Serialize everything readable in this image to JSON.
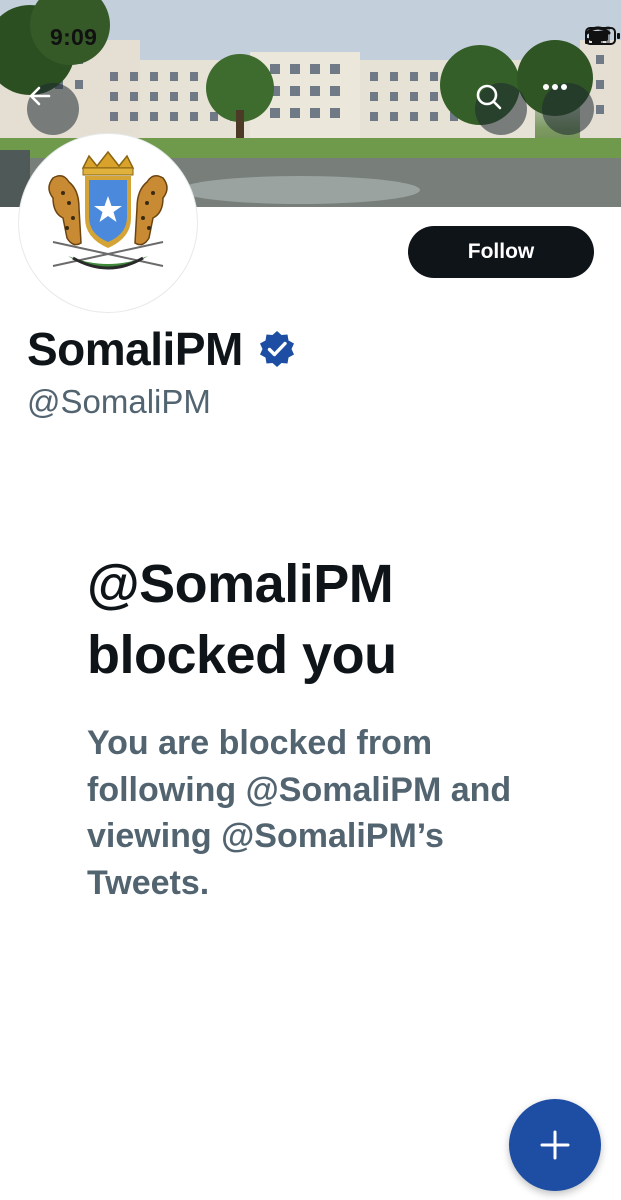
{
  "status_bar": {
    "time": "9:09"
  },
  "header": {
    "back_icon": "arrow-left-icon",
    "search_icon": "search-icon",
    "more_icon": "more-horizontal-icon"
  },
  "profile": {
    "display_name": "SomaliPM",
    "handle": "@SomaliPM",
    "verified": true,
    "verified_color": "#1d4ea3",
    "follow_label": "Follow"
  },
  "blocked": {
    "title": "@SomaliPM blocked you",
    "description": "You are blocked from following @SomaliPM and viewing @SomaliPM’s Tweets."
  },
  "fab": {
    "icon": "plus-icon",
    "color": "#1d4ea3"
  }
}
